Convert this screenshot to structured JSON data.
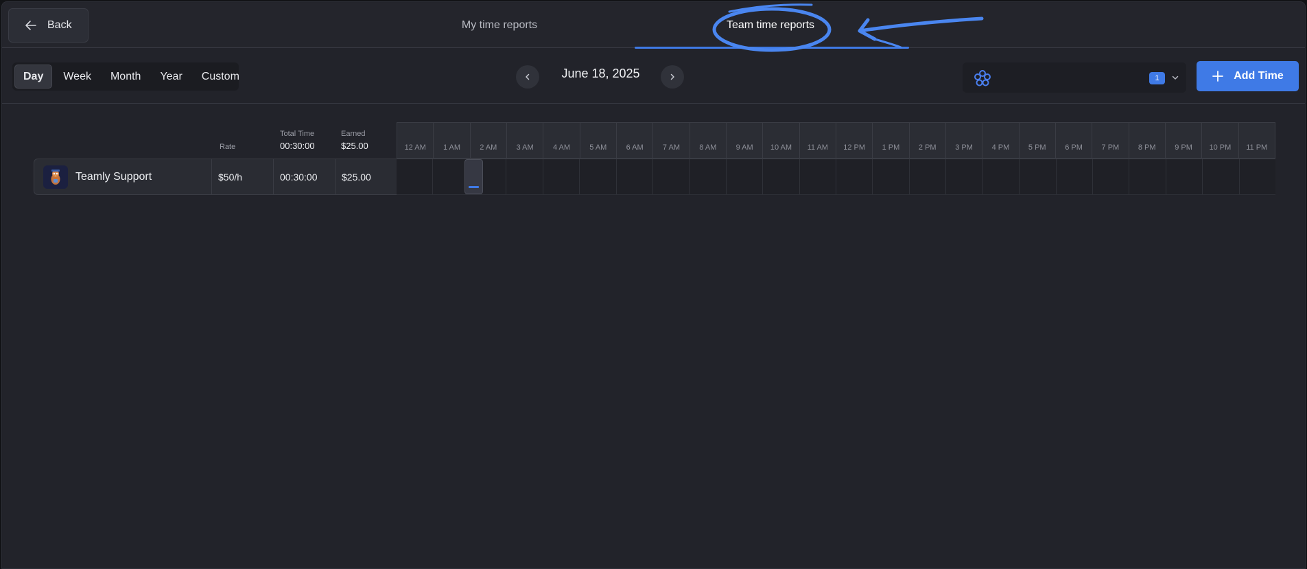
{
  "header": {
    "back_label": "Back",
    "tabs": [
      {
        "label": "My time reports",
        "active": false
      },
      {
        "label": "Team time reports",
        "active": true
      }
    ]
  },
  "toolbar": {
    "periods": [
      "Day",
      "Week",
      "Month",
      "Year",
      "Custom"
    ],
    "active_period": "Day",
    "date": "June 18, 2025",
    "team_count": "1",
    "add_label": "Add Time"
  },
  "grid": {
    "columns": {
      "rate": {
        "label": "Rate"
      },
      "total_time": {
        "label": "Total Time",
        "value": "00:30:00"
      },
      "earned": {
        "label": "Earned",
        "value": "$25.00"
      }
    },
    "hours": [
      "12 AM",
      "1 AM",
      "2 AM",
      "3 AM",
      "4 AM",
      "5 AM",
      "6 AM",
      "7 AM",
      "8 AM",
      "9 AM",
      "10 AM",
      "11 AM",
      "12 PM",
      "1 PM",
      "2 PM",
      "3 PM",
      "4 PM",
      "5 PM",
      "6 PM",
      "7 PM",
      "8 PM",
      "9 PM",
      "10 PM",
      "11 PM"
    ],
    "rows": [
      {
        "name": "Teamly Support",
        "rate": "$50/h",
        "total_time": "00:30:00",
        "earned": "$25.00"
      }
    ]
  },
  "colors": {
    "accent": "#3f7ae6",
    "background": "#22232a",
    "annotation": "#4a86f0"
  }
}
